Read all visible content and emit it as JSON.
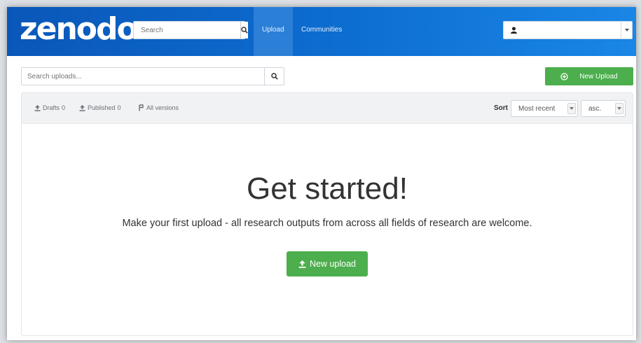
{
  "brand": {
    "logo_text": "zenodo",
    "primary_color": "#0d6ed2",
    "success_color": "#4cae4c"
  },
  "navbar": {
    "search_placeholder": "Search",
    "links": [
      {
        "label": "Upload",
        "active": true
      },
      {
        "label": "Communities",
        "active": false
      }
    ],
    "user_icon": "user-icon"
  },
  "toolbar": {
    "search_placeholder": "Search uploads...",
    "new_upload_label": "New Upload",
    "new_upload_icon": "plus-circle-icon"
  },
  "filters": {
    "drafts_label": "Drafts",
    "drafts_count": "0",
    "published_label": "Published",
    "published_count": "0",
    "all_versions_label": "All versions"
  },
  "sort": {
    "label": "Sort",
    "order_by": "Most recent",
    "direction": "asc."
  },
  "empty_state": {
    "title": "Get started!",
    "subtitle": "Make your first upload - all research outputs from across all fields of research are welcome.",
    "button_label": "New upload",
    "button_icon": "upload-icon"
  }
}
